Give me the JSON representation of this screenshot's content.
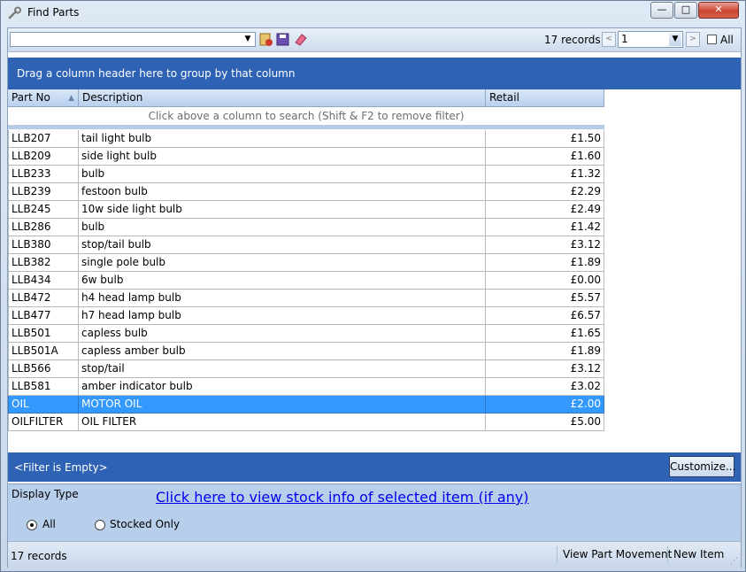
{
  "window": {
    "title": "Find Parts",
    "minimize": "—",
    "maximize": "□",
    "close": "✕"
  },
  "toolbar": {
    "search_value": "",
    "records_count": "17 records",
    "page_value": "1",
    "all_label": "All",
    "all_checked": false,
    "prev_page": "<",
    "next_page": ">"
  },
  "group_hint": "Drag a column header here to group by that column",
  "table": {
    "columns": [
      "Part No",
      "Description",
      "Retail"
    ],
    "filter_hint": "Click above a column to search (Shift & F2 to remove filter)",
    "rows": [
      {
        "part_no": "LLB207",
        "description": "tail light bulb",
        "retail": "£1.50"
      },
      {
        "part_no": "LLB209",
        "description": "side light bulb",
        "retail": "£1.60"
      },
      {
        "part_no": "LLB233",
        "description": "bulb",
        "retail": "£1.32"
      },
      {
        "part_no": "LLB239",
        "description": "festoon bulb",
        "retail": "£2.29"
      },
      {
        "part_no": "LLB245",
        "description": "10w side light bulb",
        "retail": "£2.49"
      },
      {
        "part_no": "LLB286",
        "description": "bulb",
        "retail": "£1.42"
      },
      {
        "part_no": "LLB380",
        "description": "stop/tail bulb",
        "retail": "£3.12"
      },
      {
        "part_no": "LLB382",
        "description": "single pole bulb",
        "retail": "£1.89"
      },
      {
        "part_no": "LLB434",
        "description": "6w bulb",
        "retail": "£0.00"
      },
      {
        "part_no": "LLB472",
        "description": "h4 head lamp bulb",
        "retail": "£5.57"
      },
      {
        "part_no": "LLB477",
        "description": "h7 head lamp bulb",
        "retail": "£6.57"
      },
      {
        "part_no": "LLB501",
        "description": "capless bulb",
        "retail": "£1.65"
      },
      {
        "part_no": "LLB501A",
        "description": "capless amber bulb",
        "retail": "£1.89"
      },
      {
        "part_no": "LLB566",
        "description": "stop/tail",
        "retail": "£3.12"
      },
      {
        "part_no": "LLB581",
        "description": "amber indicator bulb",
        "retail": "£3.02"
      },
      {
        "part_no": "OIL",
        "description": "MOTOR OIL",
        "retail": "£2.00",
        "selected": true
      },
      {
        "part_no": "OILFILTER",
        "description": "OIL FILTER",
        "retail": "£5.00"
      }
    ]
  },
  "filter_bar": {
    "text": "<Filter is Empty>",
    "customize_label": "Customize..."
  },
  "bottom": {
    "display_type_label": "Display Type",
    "stock_link": "Click here to view stock info of selected item (if any)",
    "radio_all": "All",
    "radio_stocked": "Stocked Only",
    "selected_option": "All"
  },
  "status": {
    "records": "17 records",
    "view_part_movement": "View Part Movement",
    "new_item": "New Item"
  },
  "colors": {
    "header_blue": "#2d62b5",
    "selection_blue": "#3399ff",
    "link_blue": "#0000ee"
  }
}
